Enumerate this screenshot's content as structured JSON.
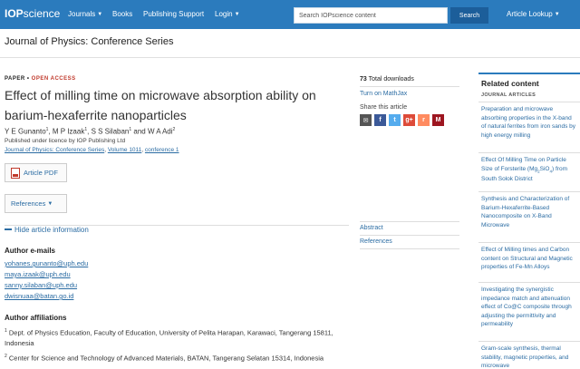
{
  "brand": {
    "iop": "IOP",
    "science": "science"
  },
  "nav": {
    "journals": "Journals",
    "books": "Books",
    "publishing_support": "Publishing Support",
    "login": "Login",
    "article_lookup": "Article Lookup"
  },
  "search": {
    "placeholder": "Search IOPscience content",
    "button": "Search"
  },
  "journal": {
    "title": "Journal of Physics: Conference Series"
  },
  "article": {
    "type": "PAPER",
    "access": "OPEN ACCESS",
    "title": "Effect of milling time on microwave absorption ability on barium-hexaferrite nanoparticles",
    "authors": [
      {
        "name": "Y E Gunanto",
        "sup": "1"
      },
      {
        "name": "M P Izaak",
        "sup": "1"
      },
      {
        "name": "S S Silaban",
        "sup": "1"
      },
      {
        "name": "W A Adi",
        "sup": "2"
      }
    ],
    "licence": "Published under licence by IOP Publishing Ltd",
    "citation": {
      "journal": "Journal of Physics: Conference Series",
      "volume": "Volume 1011",
      "issue": "conference 1"
    },
    "pdf_button": "Article PDF",
    "references_button": "References",
    "hide_info": "Hide article information",
    "emails_heading": "Author e-mails",
    "emails": [
      "yohanes.gunanto@uph.edu",
      "maya.izaak@uph.edu",
      "sanny.silaban@uph.edu",
      "dwisnuaa@batan.go.id"
    ],
    "affiliations_heading": "Author affiliations",
    "affiliations": [
      {
        "sup": "1",
        "text": "Dept. of Physics Education, Faculty of Education, University of Pelita Harapan, Karawaci, Tangerang 15811, Indonesia"
      },
      {
        "sup": "2",
        "text": "Center for Science and Technology of Advanced Materials, BATAN, Tangerang Selatan 15314, Indonesia"
      }
    ]
  },
  "metrics": {
    "downloads_count": "73",
    "downloads_label": "Total downloads",
    "mathjax": "Turn on MathJax",
    "share_label": "Share this article",
    "share_icons": [
      "email-icon",
      "facebook-icon",
      "twitter-icon",
      "google-plus-icon",
      "reddit-icon",
      "mendeley-icon"
    ],
    "abstract_link": "Abstract",
    "references_link": "References"
  },
  "related": {
    "title": "Related content",
    "subtitle": "JOURNAL ARTICLES",
    "items": [
      "Preparation and microwave absorbing properties in the X-band of natural ferrites from iron sands by high energy milling",
      "Synthesis and Characterization of Barium-Hexaferrite-Based Nanocomposite on X-Band Microwave",
      "Effect of Milling times and Carbon content on Structural and Magnetic properties of Fe-Mn Alloys",
      "Investigating the synergistic impedance match and attenuation effect of Co@C composite through adjusting the permittivity and permeability",
      "Gram-scale synthesis, thermal stability, magnetic properties, and microwave"
    ],
    "item_forsterite": {
      "before": "Effect Of Milling Time on Particle Size of Forsterite (Mg",
      "sub": "2",
      "mid": "SiO",
      "sub2": "4",
      "after": ") from South Solok District"
    }
  },
  "colors": {
    "topbar": "#2b7bbd",
    "link": "#2b6ca3",
    "open_access": "#c0392b",
    "search_button": "#1c5e9a"
  }
}
